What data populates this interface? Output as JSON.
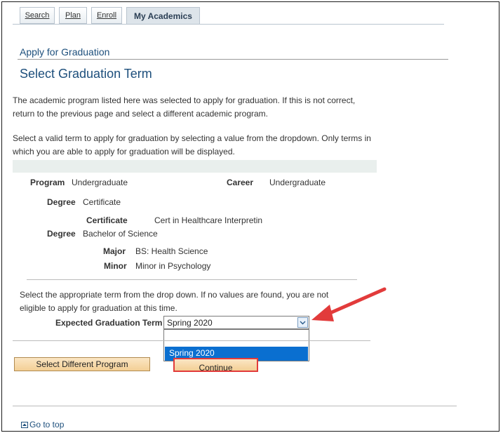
{
  "tabs": [
    {
      "label": "Search"
    },
    {
      "label": "Plan"
    },
    {
      "label": "Enroll"
    },
    {
      "label": "My Academics"
    }
  ],
  "breadcrumb": "Apply for Graduation",
  "page_title": "Select Graduation Term",
  "intro_1": "The academic program listed here was selected to apply for graduation. If this is not correct, return to the previous page and select a different academic program.",
  "intro_2": "Select a valid term to apply for graduation by selecting a value from the dropdown. Only terms in which you are able to apply for graduation will be displayed.",
  "program": {
    "program_label": "Program",
    "program_value": "Undergraduate",
    "career_label": "Career",
    "career_value": "Undergraduate",
    "degree1_label": "Degree",
    "degree1_value": "Certificate",
    "certificate_label": "Certificate",
    "certificate_value": "Cert in Healthcare Interpretin",
    "degree2_label": "Degree",
    "degree2_value": "Bachelor of Science",
    "major_label": "Major",
    "major_value": "BS: Health Science",
    "minor_label": "Minor",
    "minor_value": "Minor in Psychology"
  },
  "term_instructions": "Select the appropriate term from the drop down. If no values are found, you are not eligible to apply for graduation at this time.",
  "term_label": "Expected Graduation Term",
  "term_selected": "Spring 2020",
  "term_options": [
    "",
    "Spring 2020"
  ],
  "buttons": {
    "select_different": "Select Different Program",
    "continue": "Continue"
  },
  "go_to_top": "Go to top",
  "colors": {
    "accent": "#1d4f7c",
    "highlight": "#0a6fd0",
    "annotation": "#e23b3b"
  }
}
